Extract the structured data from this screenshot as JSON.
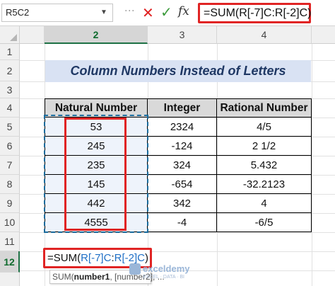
{
  "formula_bar": {
    "name_box": "R5C2",
    "formula": "=SUM(R[-7]C:R[-2]C)",
    "fx_label": "fx",
    "cancel_icon": "close-x-icon",
    "enter_icon": "checkmark-icon"
  },
  "columns": [
    "2",
    "3",
    "4"
  ],
  "rows": [
    "1",
    "2",
    "3",
    "4",
    "5",
    "6",
    "7",
    "8",
    "9",
    "10",
    "11",
    "12"
  ],
  "selected_row": "12",
  "selected_column": "2",
  "title": "Column Numbers Instead of Letters",
  "table": {
    "headers": [
      "Natural Number",
      "Integer",
      "Rational Number"
    ],
    "rows": [
      [
        "53",
        "2324",
        "4/5"
      ],
      [
        "245",
        "-124",
        "2 1/2"
      ],
      [
        "235",
        "324",
        "5.432"
      ],
      [
        "145",
        "-654",
        "-32.2123"
      ],
      [
        "442",
        "342",
        "4"
      ],
      [
        "4555",
        "-4",
        "-6/5"
      ]
    ]
  },
  "cell_formula": {
    "prefix": "=SUM(",
    "ref1": "R[-7]C",
    "colon": ":",
    "ref2": "R[-2]C",
    "suffix": ")"
  },
  "tooltip": {
    "func": "SUM(",
    "arg1": "number1",
    "rest": ", [number2], ..."
  },
  "watermark": {
    "name": "exceldemy",
    "tagline": "EXCEL · DATA · BI"
  },
  "colors": {
    "highlight_red": "#e02424",
    "title_fill": "#d9e2f3",
    "header_fill": "#d9d9d9",
    "selection_dash": "#1a6b9c",
    "excel_green": "#1e7145"
  }
}
